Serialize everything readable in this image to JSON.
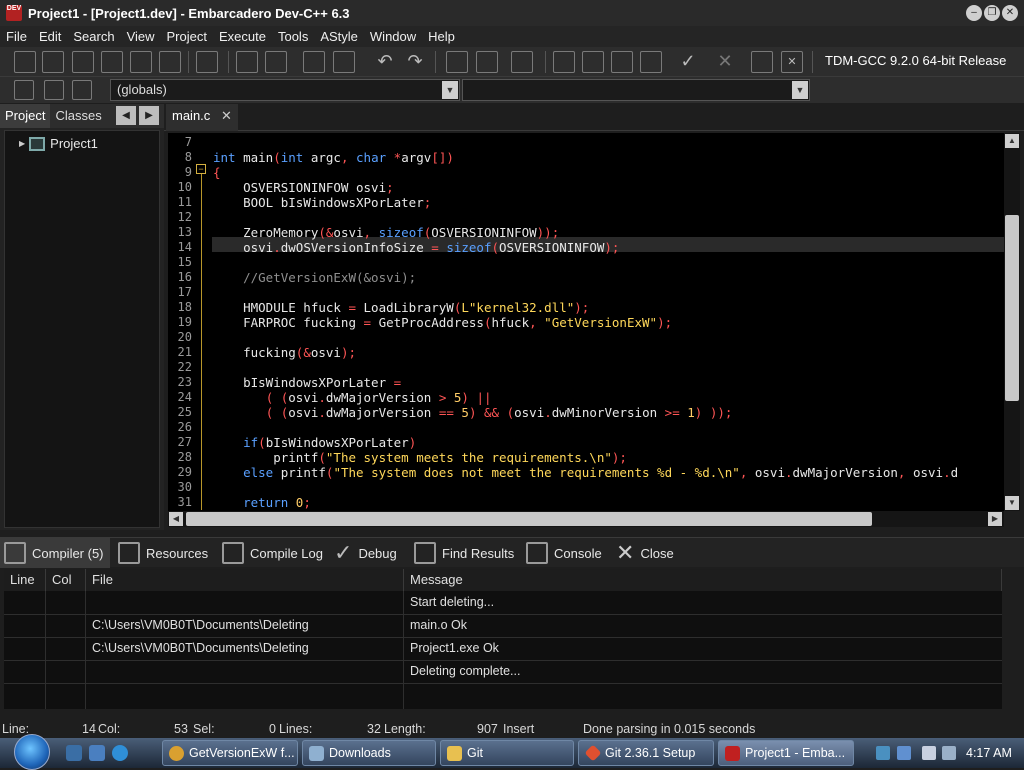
{
  "window": {
    "title": "Project1 - [Project1.dev] - Embarcadero Dev-C++ 6.3",
    "app_icon": "DEV\nC++"
  },
  "menu": [
    "File",
    "Edit",
    "Search",
    "View",
    "Project",
    "Execute",
    "Tools",
    "AStyle",
    "Window",
    "Help"
  ],
  "toolbar": {
    "compiler": "TDM-GCC 9.2.0 64-bit Release",
    "scope": "(globals)",
    "symbol": ""
  },
  "left_panel": {
    "tabs": [
      "Project",
      "Classes"
    ],
    "tree_root": "Project1"
  },
  "editor": {
    "tab": "main.c",
    "line_numbers": [
      "7",
      "8",
      "9",
      "10",
      "11",
      "12",
      "13",
      "14",
      "15",
      "16",
      "17",
      "18",
      "19",
      "20",
      "21",
      "22",
      "23",
      "24",
      "25",
      "26",
      "27",
      "28",
      "29",
      "30",
      "31"
    ],
    "lines": [
      "",
      "int main(int argc, char *argv[])",
      "{",
      "    OSVERSIONINFOW osvi;",
      "    BOOL bIsWindowsXPorLater;",
      "",
      "    ZeroMemory(&osvi, sizeof(OSVERSIONINFOW));",
      "    osvi.dwOSVersionInfoSize = sizeof(OSVERSIONINFOW);",
      "",
      "    //GetVersionExW(&osvi);",
      "",
      "    HMODULE hfuck = LoadLibraryW(L\"kernel32.dll\");",
      "    FARPROC fucking = GetProcAddress(hfuck, \"GetVersionExW\");",
      "",
      "    fucking(&osvi);",
      "",
      "    bIsWindowsXPorLater =",
      "       ( (osvi.dwMajorVersion > 5) ||",
      "       ( (osvi.dwMajorVersion == 5) && (osvi.dwMinorVersion >= 1) ));",
      "",
      "    if(bIsWindowsXPorLater)",
      "        printf(\"The system meets the requirements.\\n\");",
      "    else printf(\"The system does not meet the requirements %d - %d.\\n\", osvi.dwMajorVersion, osvi.d",
      "",
      "    return 0;"
    ]
  },
  "bottom_tabs": [
    "Compiler (5)",
    "Resources",
    "Compile Log",
    "Debug",
    "Find Results",
    "Console",
    "Close"
  ],
  "results": {
    "headers": [
      "Line",
      "Col",
      "File",
      "Message"
    ],
    "rows": [
      {
        "line": "",
        "col": "",
        "file": "",
        "message": "Start deleting..."
      },
      {
        "line": "",
        "col": "",
        "file": "C:\\Users\\VM0B0T\\Documents\\Deleting",
        "message": "main.o Ok"
      },
      {
        "line": "",
        "col": "",
        "file": "C:\\Users\\VM0B0T\\Documents\\Deleting",
        "message": "Project1.exe Ok"
      },
      {
        "line": "",
        "col": "",
        "file": "",
        "message": "Deleting complete..."
      }
    ]
  },
  "status": {
    "line_label": "Line:",
    "line": "14",
    "col_label": "Col:",
    "col": "53",
    "sel_label": "Sel:",
    "sel": "0",
    "lines_label": "Lines:",
    "lines": "32",
    "length_label": "Length:",
    "length": "907",
    "mode": "Insert",
    "message": "Done parsing in 0.015 seconds"
  },
  "taskbar": {
    "tasks": [
      "GetVersionExW f...",
      "Downloads",
      "Git",
      "Git 2.36.1 Setup",
      "Project1 - Emba..."
    ],
    "clock": "4:17 AM"
  }
}
